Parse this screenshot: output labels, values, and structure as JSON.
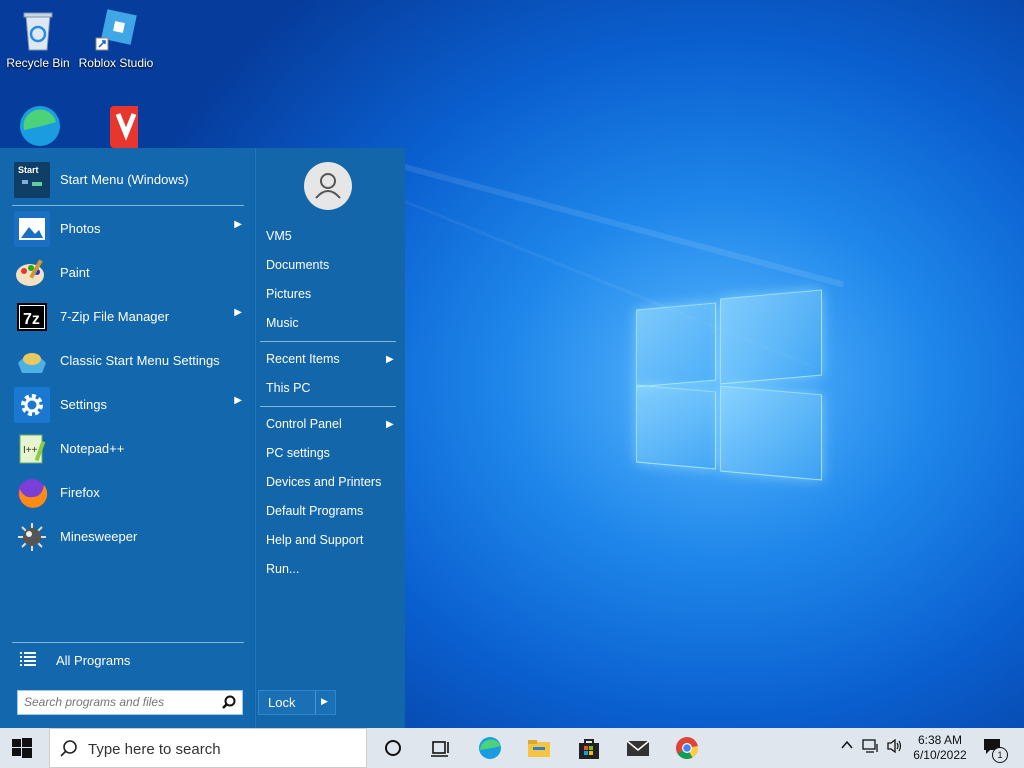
{
  "desktop": {
    "icons": [
      {
        "label": "Recycle Bin"
      },
      {
        "label": "Roblox Studio"
      }
    ]
  },
  "start_menu": {
    "programs": [
      {
        "label": "Start Menu (Windows)",
        "has_submenu": false
      },
      {
        "label": "Photos",
        "has_submenu": true
      },
      {
        "label": "Paint",
        "has_submenu": false
      },
      {
        "label": "7-Zip File Manager",
        "has_submenu": true
      },
      {
        "label": "Classic Start Menu Settings",
        "has_submenu": false
      },
      {
        "label": "Settings",
        "has_submenu": true
      },
      {
        "label": "Notepad++",
        "has_submenu": false
      },
      {
        "label": "Firefox",
        "has_submenu": false
      },
      {
        "label": "Minesweeper",
        "has_submenu": false
      }
    ],
    "start_icon_text": "Start",
    "all_programs": "All Programs",
    "search_placeholder": "Search programs and files",
    "right_items": [
      {
        "label": "VM5"
      },
      {
        "label": "Documents"
      },
      {
        "label": "Pictures"
      },
      {
        "label": "Music"
      },
      {
        "label": "Recent Items",
        "has_submenu": true
      },
      {
        "label": "This PC"
      },
      {
        "label": "Control Panel",
        "has_submenu": true
      },
      {
        "label": "PC settings"
      },
      {
        "label": "Devices and Printers"
      },
      {
        "label": "Default Programs"
      },
      {
        "label": "Help and Support"
      },
      {
        "label": "Run..."
      }
    ],
    "lock_label": "Lock",
    "submenu_arrow": "▶"
  },
  "taskbar": {
    "search_text": "Type here to search",
    "apps": [
      "task-view",
      "edge",
      "file-explorer",
      "store",
      "mail",
      "chrome"
    ],
    "clock": {
      "time": "6:38 AM",
      "date": "6/10/2022"
    },
    "notification_count": "1"
  }
}
